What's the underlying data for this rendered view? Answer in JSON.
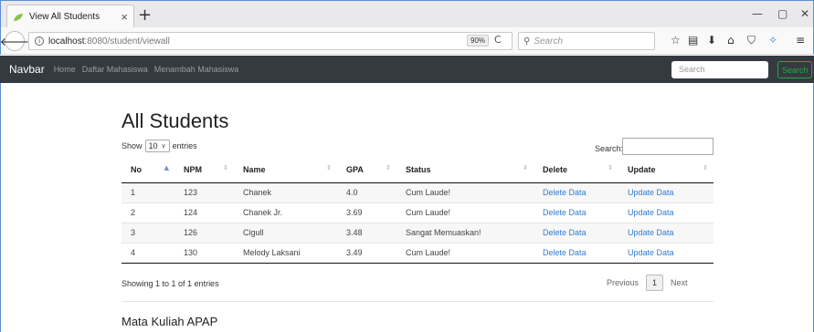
{
  "browser": {
    "tab_title": "View All Students",
    "tab_close": "×",
    "new_tab": "+",
    "url_host": "localhost",
    "url_path": ":8080/student/viewall",
    "zoom": "90%",
    "search_placeholder": "Search",
    "window_controls": [
      "—",
      "▢",
      "✕"
    ]
  },
  "navbar": {
    "brand": "Navbar",
    "links": [
      "Home",
      "Daftar Mahasiswa",
      "Menambah Mahasiswa"
    ],
    "search_placeholder": "Search",
    "search_button": "Search"
  },
  "page": {
    "title": "All Students",
    "show_label": "Show",
    "show_value": "10",
    "entries_label": "entries",
    "search_label": "Search:",
    "columns": [
      "No",
      "NPM",
      "Name",
      "GPA",
      "Status",
      "Delete",
      "Update"
    ],
    "rows": [
      {
        "no": "1",
        "npm": "123",
        "name": "Chanek",
        "gpa": "4.0",
        "status": "Cum Laude!",
        "delete": "Delete Data",
        "update": "Update Data"
      },
      {
        "no": "2",
        "npm": "124",
        "name": "Chanek Jr.",
        "gpa": "3.69",
        "status": "Cum Laude!",
        "delete": "Delete Data",
        "update": "Update Data"
      },
      {
        "no": "3",
        "npm": "126",
        "name": "Cigull",
        "gpa": "3.48",
        "status": "Sangat Memuaskan!",
        "delete": "Delete Data",
        "update": "Update Data"
      },
      {
        "no": "4",
        "npm": "130",
        "name": "Melody Laksani",
        "gpa": "3.49",
        "status": "Cum Laude!",
        "delete": "Delete Data",
        "update": "Update Data"
      }
    ],
    "info": "Showing 1 to 1 of 1 entries",
    "pagination": {
      "previous": "Previous",
      "page": "1",
      "next": "Next"
    },
    "subtitle": "Mata Kuliah APAP"
  },
  "colors": {
    "navbar_bg": "#343a40",
    "link": "#2f7bd4",
    "search_button": "#28a745"
  }
}
